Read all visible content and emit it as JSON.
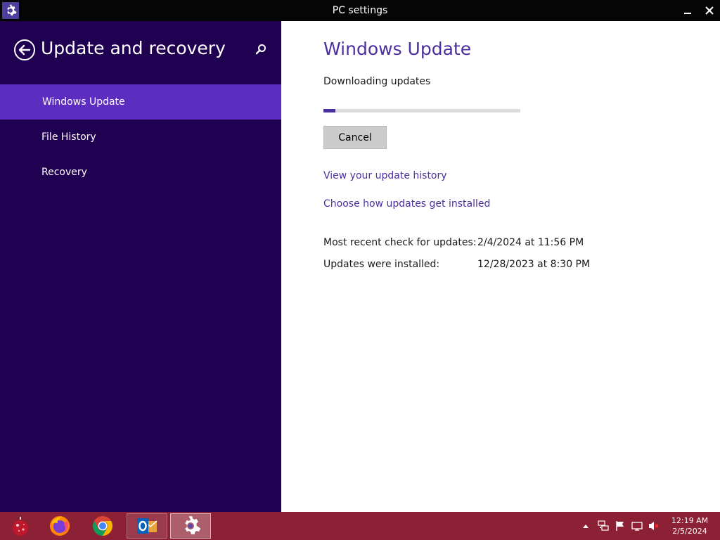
{
  "window": {
    "title": "PC settings",
    "icon": "gear-icon"
  },
  "sidebar": {
    "heading": "Update and recovery",
    "items": [
      {
        "label": "Windows Update",
        "active": true
      },
      {
        "label": "File History",
        "active": false
      },
      {
        "label": "Recovery",
        "active": false
      }
    ]
  },
  "main": {
    "title": "Windows Update",
    "status": "Downloading updates",
    "progress": 0.06,
    "cancel_label": "Cancel",
    "links": {
      "history": "View your update history",
      "choose": "Choose how updates get installed"
    },
    "info": [
      {
        "label": "Most recent check for updates:",
        "value": "2/4/2024 at 11:56 PM"
      },
      {
        "label": "Updates were installed:",
        "value": "12/28/2023 at 8:30 PM"
      }
    ]
  },
  "taskbar": {
    "apps": [
      "start-ornament-icon",
      "firefox-icon",
      "chrome-icon",
      "outlook-icon",
      "settings-icon"
    ],
    "clock": {
      "time": "12:19 AM",
      "date": "2/5/2024"
    }
  },
  "colors": {
    "sidebar_bg": "#200050",
    "accent": "#5c2dbe",
    "title_text": "#4c2f9e",
    "taskbar": "#8c2034"
  }
}
